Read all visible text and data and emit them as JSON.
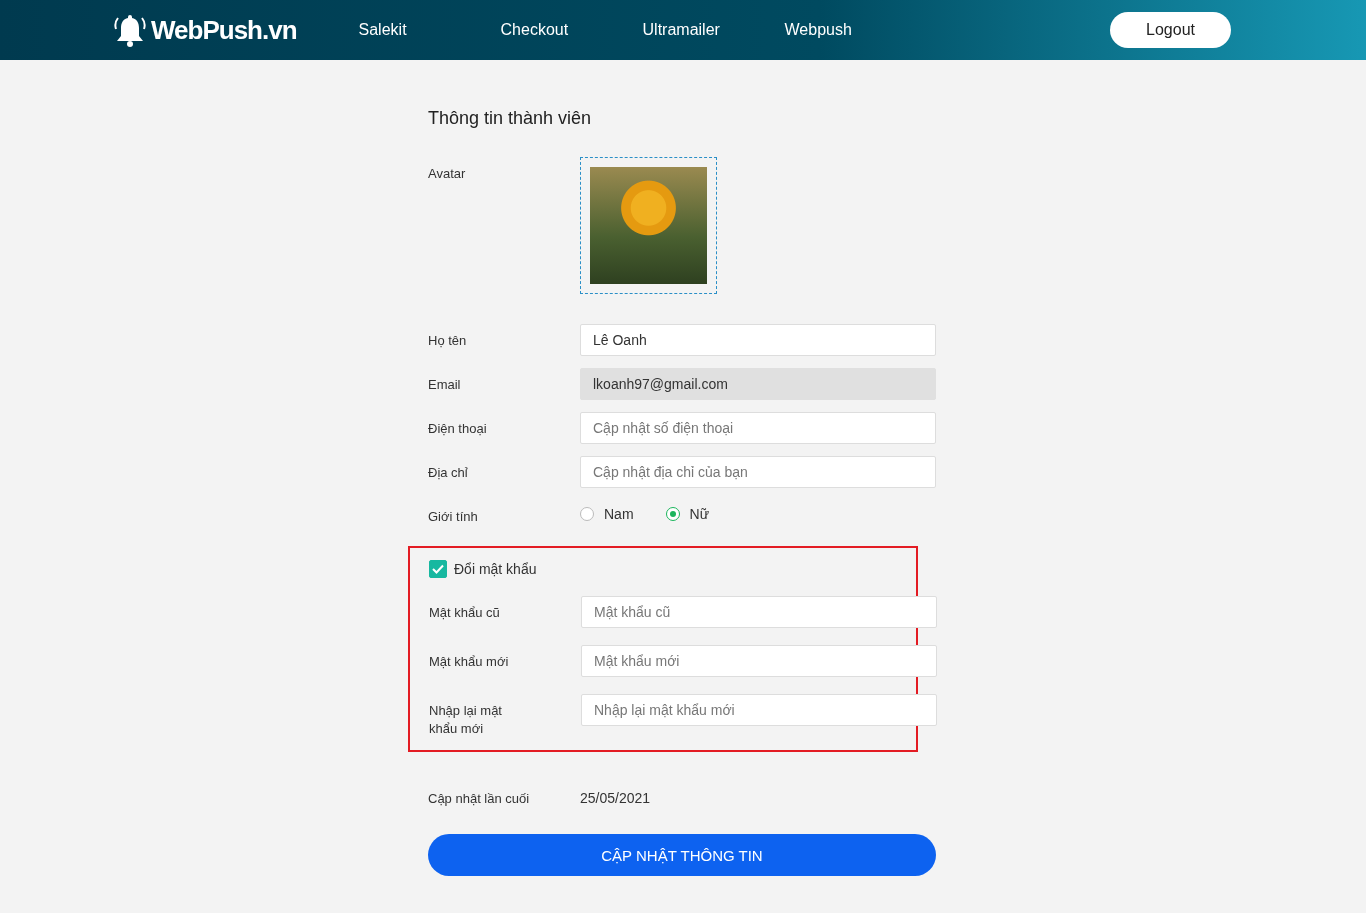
{
  "header": {
    "logo": "WebPush.vn",
    "nav": [
      {
        "label": "Salekit"
      },
      {
        "label": "Checkout"
      },
      {
        "label": "Ultramailer"
      },
      {
        "label": "Webpush"
      }
    ],
    "logout": "Logout"
  },
  "form": {
    "title": "Thông tin thành viên",
    "avatar_label": "Avatar",
    "fields": [
      {
        "label": "Họ tên",
        "value": "Lê Oanh",
        "disabled": false
      },
      {
        "label": "Email",
        "value": "lkoanh97@gmail.com",
        "disabled": true
      },
      {
        "label": "Điện thoại",
        "placeholder": "Cập nhật số điện thoại",
        "disabled": false
      },
      {
        "label": "Địa chỉ",
        "placeholder": "Cập nhật địa chỉ của bạn",
        "disabled": false
      }
    ],
    "gender": {
      "label": "Giới tính",
      "options": [
        {
          "label": "Nam",
          "selected": false
        },
        {
          "label": "Nữ",
          "selected": true
        }
      ]
    },
    "password_section": {
      "highlighted": true,
      "toggle": {
        "label": "Đổi mật khẩu",
        "checked": true
      },
      "fields": [
        {
          "label": "Mật khẩu cũ",
          "placeholder": "Mật khẩu cũ"
        },
        {
          "label": "Mật khẩu mới",
          "placeholder": "Mật khẩu mới"
        },
        {
          "label": "Nhập lại mật khẩu mới",
          "placeholder": "Nhập lại mật khẩu mới"
        }
      ]
    },
    "last_updated": {
      "label": "Cập nhật lần cuối",
      "value": "25/05/2021"
    },
    "submit": "CẬP NHẬT THÔNG TIN"
  }
}
